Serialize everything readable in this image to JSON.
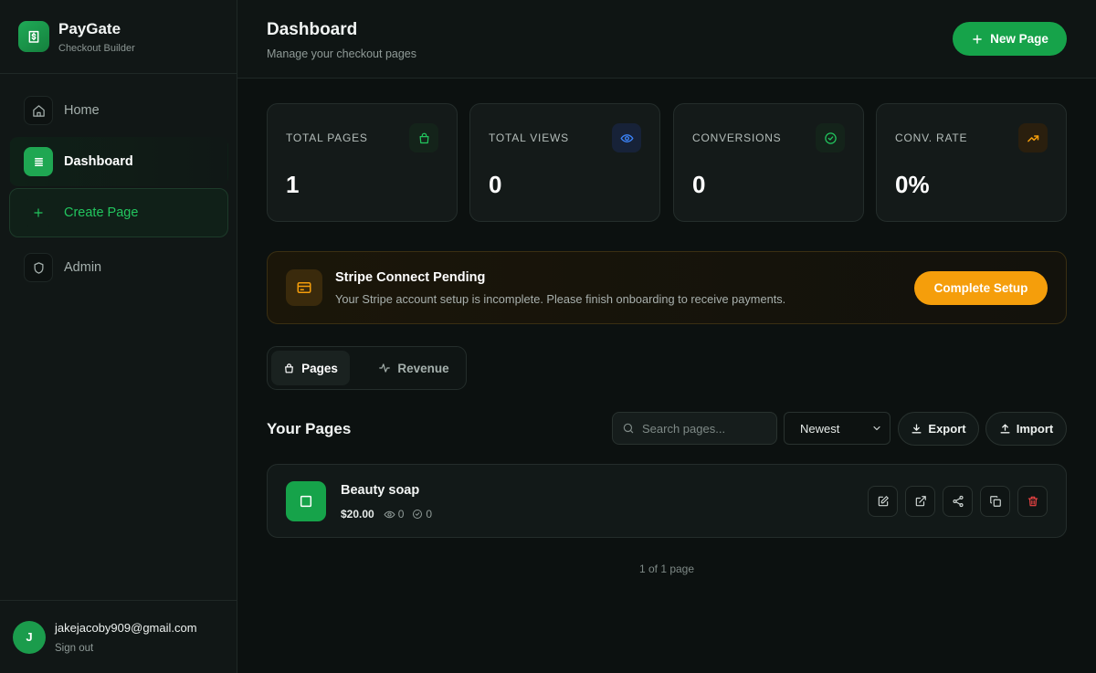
{
  "brand": {
    "name": "PayGate",
    "subtitle": "Checkout Builder"
  },
  "sidebar": {
    "items": [
      {
        "label": "Home",
        "icon": "home-icon"
      },
      {
        "label": "Dashboard",
        "icon": "list-icon",
        "active": true
      },
      {
        "label": "Create Page",
        "icon": "plus-icon"
      },
      {
        "label": "Admin",
        "icon": "shield-icon"
      }
    ]
  },
  "user": {
    "initial": "J",
    "email": "jakejacoby909@gmail.com",
    "sign_out": "Sign out"
  },
  "header": {
    "title": "Dashboard",
    "subtitle": "Manage your checkout pages",
    "new_page_label": "New Page"
  },
  "stats": [
    {
      "label": "TOTAL PAGES",
      "value": "1",
      "icon": "bag-icon",
      "color": "#22c55e"
    },
    {
      "label": "TOTAL VIEWS",
      "value": "0",
      "icon": "eye-icon",
      "color": "#3b82f6"
    },
    {
      "label": "CONVERSIONS",
      "value": "0",
      "icon": "check-circle-icon",
      "color": "#22c55e"
    },
    {
      "label": "CONV. RATE",
      "value": "0%",
      "icon": "trending-up-icon",
      "color": "#f59e0b"
    }
  ],
  "banner": {
    "title": "Stripe Connect Pending",
    "text": "Your Stripe account setup is incomplete. Please finish onboarding to receive payments.",
    "button": "Complete Setup"
  },
  "tabs": [
    {
      "label": "Pages",
      "active": true
    },
    {
      "label": "Revenue",
      "active": false
    }
  ],
  "pages_section": {
    "title": "Your Pages",
    "search_placeholder": "Search pages...",
    "sort_value": "Newest",
    "export_label": "Export",
    "import_label": "Import"
  },
  "pages": [
    {
      "name": "Beauty soap",
      "price": "$20.00",
      "views": "0",
      "conversions": "0"
    }
  ],
  "pagination": "1 of 1 page",
  "colors": {
    "accent": "#16a34a",
    "warning": "#f59e0b",
    "danger": "#ef4444",
    "background": "#0c1110"
  }
}
